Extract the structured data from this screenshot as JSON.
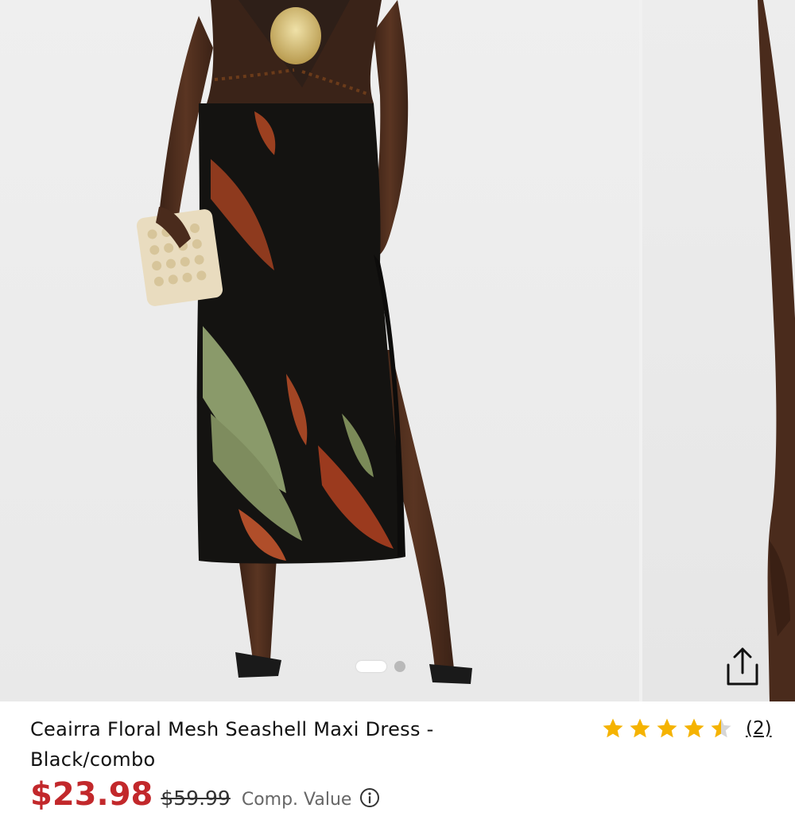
{
  "gallery": {
    "slide_count": 2,
    "active_slide": 1
  },
  "product": {
    "title": "Ceairra Floral Mesh Seashell Maxi Dress - Black/combo",
    "rating": 4.5,
    "rating_max": 5,
    "review_count": "(2)",
    "price": "$23.98",
    "compare_price": "$59.99",
    "compare_label": "Comp. Value"
  },
  "icons": {
    "share": "share-icon",
    "star": "star-icon",
    "info": "info-icon"
  },
  "colors": {
    "price": "#c2282b",
    "star": "#f5b301",
    "star_empty": "#d6d6d6",
    "text": "#111111"
  }
}
